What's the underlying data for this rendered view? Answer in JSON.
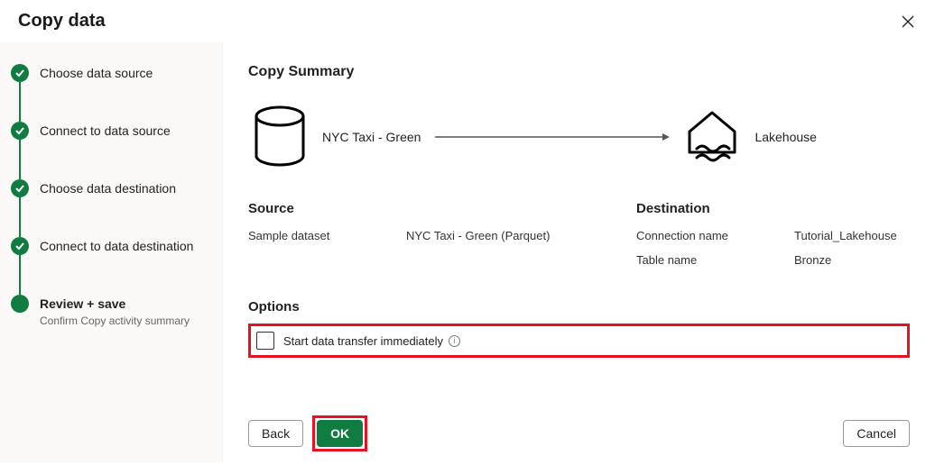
{
  "dialog": {
    "title": "Copy data"
  },
  "steps": {
    "s1": "Choose data source",
    "s2": "Connect to data source",
    "s3": "Choose data destination",
    "s4": "Connect to data destination",
    "s5": "Review + save",
    "s5_sub": "Confirm Copy activity summary"
  },
  "summary": {
    "title": "Copy Summary",
    "source_name": "NYC Taxi - Green",
    "dest_name": "Lakehouse"
  },
  "source": {
    "heading": "Source",
    "dataset_label": "Sample dataset",
    "dataset_value": "NYC Taxi - Green (Parquet)"
  },
  "destination": {
    "heading": "Destination",
    "conn_label": "Connection name",
    "conn_value": "Tutorial_Lakehouse",
    "table_label": "Table name",
    "table_value": "Bronze"
  },
  "options": {
    "heading": "Options",
    "start_immediately": "Start data transfer immediately"
  },
  "buttons": {
    "back": "Back",
    "ok": "OK",
    "cancel": "Cancel"
  }
}
